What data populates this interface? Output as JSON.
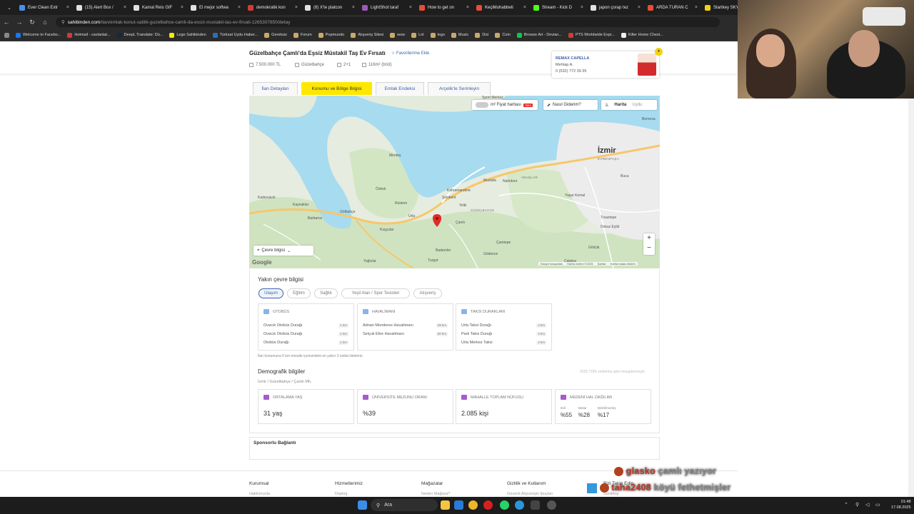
{
  "browser": {
    "tabs": [
      {
        "label": "Ever Clean Extr",
        "color": "#4a8fe7"
      },
      {
        "label": "(15) Alert Box /",
        "color": "#e0e0e0"
      },
      {
        "label": "Kamal Reis GIF",
        "color": "#e0e0e0"
      },
      {
        "label": "El mejor softwa",
        "color": "#e0e0e0"
      },
      {
        "label": "demokratik kon",
        "color": "#d23b3b"
      },
      {
        "label": "(8) X'te platcon",
        "color": "#e0e0e0"
      },
      {
        "label": "LightShot taraf",
        "color": "#9b59b6"
      },
      {
        "label": "How to get on",
        "color": "#e74c3c"
      },
      {
        "label": "KeçiMuhabbeti",
        "color": "#e74c3c"
      },
      {
        "label": "Stream - Kick D",
        "color": "#53fc18"
      },
      {
        "label": "japon çorap tez",
        "color": "#e0e0e0"
      },
      {
        "label": "ARDA TURAN C",
        "color": "#e74c3c"
      },
      {
        "label": "Startkey SKY |",
        "color": "#f4d10d"
      }
    ],
    "url_host": "sahibinden.com",
    "url_path": "/ilan/emlak-konut-satilik-guzelbahce-camli-da-essiz-mustakil-tas-ev-firsati-1265307850/detay",
    "bookmarks": [
      {
        "label": "Welcome to Facebo...",
        "color": "#1877f2"
      },
      {
        "label": "Hotmail - cavlantat...",
        "color": "#d23b3b"
      },
      {
        "label": "DeepL Translate: Dü...",
        "color": "#0f2b46"
      },
      {
        "label": "Lego Sahibinden",
        "color": "#ffe800"
      },
      {
        "label": "Türksat Uydu Haber...",
        "color": "#2c6fb7"
      },
      {
        "label": "Gereksiz",
        "color": "#c8a96b"
      },
      {
        "label": "Forum",
        "color": "#c8a96b"
      },
      {
        "label": "Popmundo",
        "color": "#c8a96b"
      },
      {
        "label": "Alışveriş Sitesi",
        "color": "#c8a96b"
      },
      {
        "label": "wow",
        "color": "#c8a96b"
      },
      {
        "label": "Lol",
        "color": "#c8a96b"
      },
      {
        "label": "lego",
        "color": "#c8a96b"
      },
      {
        "label": "Music",
        "color": "#c8a96b"
      },
      {
        "label": "Dizi",
        "color": "#c8a96b"
      },
      {
        "label": "Coin",
        "color": "#c8a96b"
      },
      {
        "label": "Browse Art - Devian...",
        "color": "#05cc47"
      },
      {
        "label": "PTS Worldwide Expr...",
        "color": "#d23b3b"
      },
      {
        "label": "Killer Home Chest...",
        "color": "#eeeeee"
      }
    ]
  },
  "listing": {
    "title": "Güzelbahçe Çamlı'da Eşsiz Müstakil Taş Ev Fırsatı",
    "fav_label": "Favorilerime Ekle",
    "price": "7.500.000 TL",
    "district": "Güzelbahçe",
    "rooms": "2+1",
    "area": "116m² (brüt)"
  },
  "agent": {
    "office": "REMAX CAPELLA",
    "name": "Mehtap A.",
    "phone": "0 (532) 772 39 35"
  },
  "tabs": [
    {
      "label": "İlan Detayları"
    },
    {
      "label": "Konumu ve Bölge Bilgisi"
    },
    {
      "label": "Emlak Endeksi"
    },
    {
      "label": "Arçelik'le Serinleyin"
    }
  ],
  "map": {
    "price_map_label": "m² Fiyat haritası",
    "new_badge": "Yeni",
    "directions_label": "Nasıl Giderim?",
    "view_map": "Harita",
    "view_satellite": "Uydu",
    "surroundings_label": "Çevre bilgisi",
    "city_label": "İzmir",
    "places": [
      "Sport Merkez",
      "Bornova",
      "Karşıyaka",
      "Menteş",
      "Özbek",
      "Rüstem",
      "Kaynaklar",
      "Narlıdere",
      "Kahramandere",
      "Şirinkent",
      "Yelki",
      "Mustafa",
      "Kocaoğlu",
      "Barbaros",
      "Gölbahçe",
      "Urla",
      "Çamlı",
      "Buca",
      "Yaşar Kemal",
      "Tınaztepe",
      "Dokuz Eylül",
      "Gölcük",
      "Kızılcaköy",
      "Kuşçular",
      "Bademler",
      "Gödence",
      "Turgut",
      "Yağcılar",
      "Çamtepe",
      "Catalca",
      "Seferihisar",
      "Kadıovacık"
    ],
    "caps_places": [
      "GÜZELBAHÇE",
      "EVRENPAŞA",
      "ABUŞLAR",
      "KARABAĞLAR",
      "İNCİRALTI"
    ],
    "zoom_in": "+",
    "zoom_out": "−",
    "attribution": [
      "Klavye kısayolları",
      "Harita verileri ©2025",
      "Şartlar",
      "Harita hatası bildirin"
    ],
    "google": "Google"
  },
  "nearby": {
    "title": "Yakın çevre bilgisi",
    "chips": [
      "Ulaşım",
      "Eğitim",
      "Sağlık",
      "Yeşil Alan / Spor Tesisleri",
      "Alışveriş"
    ],
    "cards": [
      {
        "title": "OTOBÜS",
        "rows": [
          {
            "name": "Ovacık Otobüs Durağı",
            "dist": "1 km"
          },
          {
            "name": "Ovacık Otobüs Durağı",
            "dist": "1 km"
          },
          {
            "name": "Otobüs Durağı",
            "dist": "1 km"
          }
        ]
      },
      {
        "title": "HAVALİMANI",
        "rows": [
          {
            "name": "Adnan Menderes Havalimanı",
            "dist": "29 km"
          },
          {
            "name": "Selçuk Efes Havalimanı",
            "dist": "60 km"
          }
        ]
      },
      {
        "title": "TAKSİ DURAKLARI",
        "rows": [
          {
            "name": "Urla Taksi Durağı",
            "dist": "4 km"
          },
          {
            "name": "Park Taksi Durağı",
            "dist": "4 km"
          },
          {
            "name": "Urla Merkez Taksi",
            "dist": "4 km"
          }
        ]
      }
    ],
    "note": "İlan konumuna 5 km mesafe içerisindeki en yakın 3 nokta listelenir."
  },
  "demographics": {
    "title": "Demografik bilgiler",
    "location": "İzmir / Güzelbahçe / Çamlı Mh.",
    "source": "2025 TÜİK verilerine göre hesaplanmıştır.",
    "cards": [
      {
        "title": "ORTALAMA YAŞ",
        "value": "31 yaş"
      },
      {
        "title": "ÜNİVERSİTE MEZUNU ORANI",
        "value": "%39"
      },
      {
        "title": "MAHALLE TOPLAM NÜFUSU",
        "value": "2.085 kişi"
      }
    ],
    "marital": {
      "title": "MEDENİ HAL DAĞILIMI",
      "items": [
        {
          "label": "Evli",
          "value": "%55"
        },
        {
          "label": "Bekar",
          "value": "%28"
        },
        {
          "label": "Belirtilmemiş",
          "value": "%17"
        }
      ]
    }
  },
  "sponsor": {
    "title": "Sponsorlu Bağlantı"
  },
  "footer": {
    "cols": [
      {
        "head": "Kurumsal",
        "first": "Hakkımızda"
      },
      {
        "head": "Hizmetlerimiz",
        "first": "Doping"
      },
      {
        "head": "Mağazalar",
        "first": "Neden Mağaza?"
      },
      {
        "head": "Gizlilik ve Kullanım",
        "first": "Güvenli Alışverişin İpuçları"
      },
      {
        "head": "Bizi Takip Edin",
        "first": "Sahiblog"
      }
    ]
  },
  "chat": [
    {
      "user": "glasko",
      "message": "çamlı yazıyor",
      "user_color": "#c0392b"
    },
    {
      "user": "taha2408",
      "message": "köyü fethetmişler",
      "user_color": "#c0392b"
    }
  ],
  "taskbar": {
    "search": "Ara",
    "time": "01:48",
    "date": "17.08.2025"
  }
}
